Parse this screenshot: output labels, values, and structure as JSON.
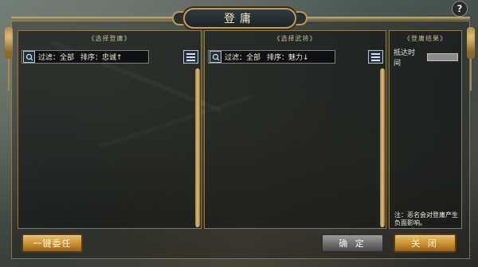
{
  "window": {
    "title": "登庸"
  },
  "help": {
    "label": "?"
  },
  "panels": {
    "recruit": {
      "header": "《选择登庸》",
      "filter_label": "过滤：",
      "filter_value": "全部",
      "sort_label": "排序：",
      "sort_value": "忠诚↑"
    },
    "officers": {
      "header": "《选择武将》",
      "filter_label": "过滤：",
      "filter_value": "全部",
      "sort_label": "排序：",
      "sort_value": "魅力↓"
    },
    "result": {
      "header": "《登庸结果》",
      "reach_label": "抵达时间",
      "note": "注：恶名会对登庸产生负面影响。"
    }
  },
  "buttons": {
    "one_click": "一键委任",
    "confirm": "确 定",
    "close": "关 闭"
  },
  "icons": {
    "search": "search-icon",
    "list": "list-icon"
  }
}
